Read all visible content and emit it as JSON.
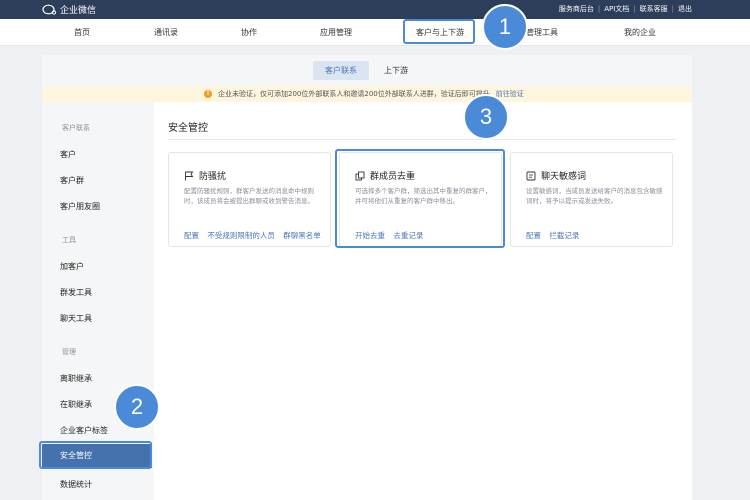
{
  "app": {
    "title": "企业微信"
  },
  "top_links": [
    "服务商后台",
    "API文档",
    "联系客服",
    "退出"
  ],
  "nav": {
    "items": [
      "首页",
      "通讯录",
      "协作",
      "应用管理",
      "客户与上下游",
      "管理工具",
      "我的企业"
    ],
    "active_index": 4
  },
  "subtabs": {
    "items": [
      "客户联系",
      "上下游"
    ],
    "active_index": 0
  },
  "notice": {
    "text": "企业未验证，仅可添加200位外部联系人和邀请200位外部联系人进群，验证后即可提升",
    "link": "前往验证"
  },
  "sidebar": {
    "groups": [
      {
        "title": "客户联系",
        "items": [
          "客户",
          "客户群",
          "客户朋友圈"
        ]
      },
      {
        "title": "工具",
        "items": [
          "加客户",
          "群发工具",
          "聊天工具"
        ]
      },
      {
        "title": "管理",
        "items": [
          "离职继承",
          "在职继承",
          "企业客户标签",
          "安全管控",
          "数据统计"
        ]
      }
    ],
    "active_item": "安全管控"
  },
  "content": {
    "title": "安全管控",
    "cards": [
      {
        "title": "防骚扰",
        "icon": "flag-icon",
        "desc": "配置防骚扰规则，群客户发送的消息命中规则时，该成员将会被提出群聊或收到警告消息。",
        "actions": [
          "配置",
          "不受规则限制的人员",
          "群聊黑名单"
        ]
      },
      {
        "title": "群成员去重",
        "icon": "dedup-icon",
        "desc": "可选择多个客户群，筛选出其中重复的群客户，并可将他们从重复的客户群中移出。",
        "actions": [
          "开始去重",
          "去重记录"
        ]
      },
      {
        "title": "聊天敏感词",
        "icon": "sensitive-word-icon",
        "desc": "设置敏感词，当成员发送给客户的消息包含敏感词时，将予以提示或发送失败。",
        "actions": [
          "配置",
          "拦截记录"
        ]
      }
    ]
  },
  "badges": [
    "1",
    "2",
    "3"
  ],
  "colors": {
    "topbar": "#2d3e5a",
    "accent": "#4a8ad6",
    "link": "#4a76b8",
    "active_sidebar": "#4571ad",
    "notice_bg": "#fdf5dd"
  }
}
